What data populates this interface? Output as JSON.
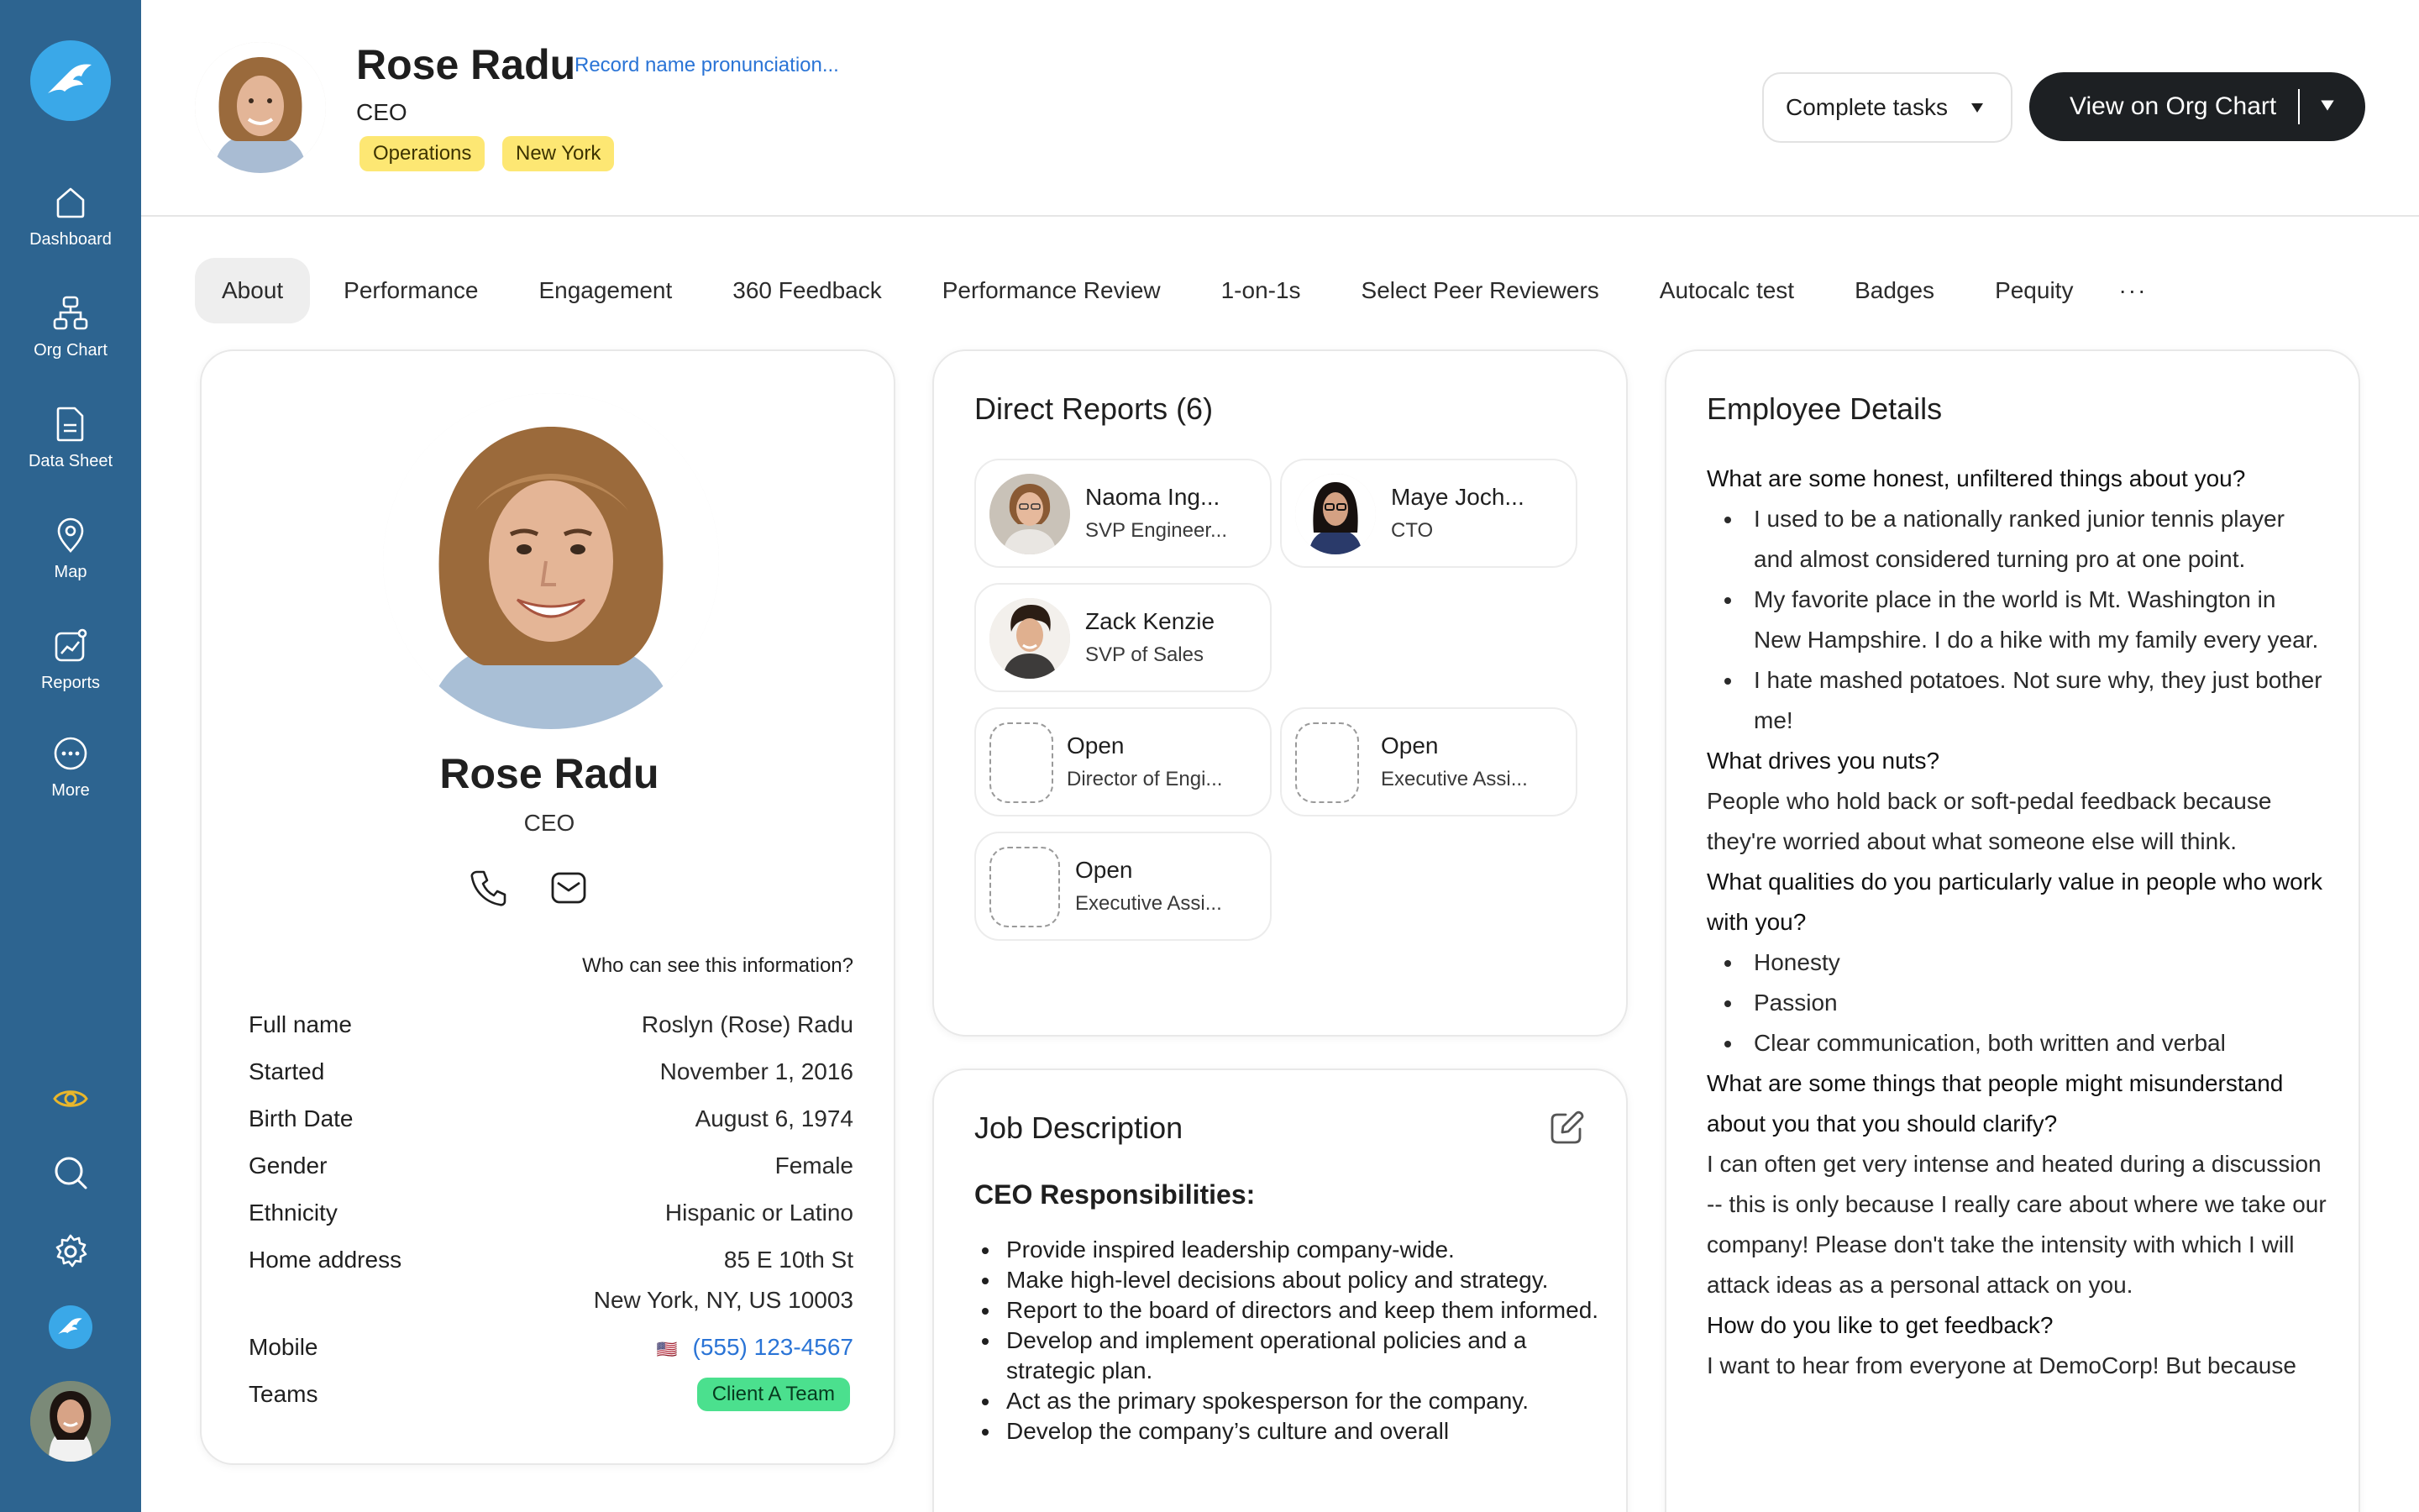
{
  "sidebar": {
    "nav": [
      {
        "label": "Dashboard",
        "icon": "home-icon"
      },
      {
        "label": "Org Chart",
        "icon": "org-chart-icon"
      },
      {
        "label": "Data Sheet",
        "icon": "data-sheet-icon"
      },
      {
        "label": "Map",
        "icon": "map-pin-icon"
      },
      {
        "label": "Reports",
        "icon": "reports-icon"
      },
      {
        "label": "More",
        "icon": "more-icon"
      }
    ],
    "bottom_icons": [
      "eye-icon",
      "search-icon",
      "gear-icon",
      "app-logo-icon",
      "user-avatar"
    ],
    "colors": {
      "background": "#2d6490",
      "logo": "#3aa8e8",
      "eye": "#e8b62c"
    }
  },
  "header": {
    "name": "Rose Radu",
    "pronunciation_link": "Record name pronunciation...",
    "title": "CEO",
    "tags": [
      "Operations",
      "New York"
    ],
    "complete_tasks_label": "Complete tasks",
    "org_chart_label": "View on Org Chart"
  },
  "tabs": [
    "About",
    "Performance",
    "Engagement",
    "360 Feedback",
    "Performance Review",
    "1-on-1s",
    "Select Peer Reviewers",
    "Autocalc test",
    "Badges",
    "Pequity"
  ],
  "tabs_more": "···",
  "profile": {
    "name": "Rose Radu",
    "title": "CEO",
    "privacy_link": "Who can see this information?",
    "fields": {
      "full_name_label": "Full name",
      "full_name": "Roslyn (Rose) Radu",
      "started_label": "Started",
      "started": "November 1, 2016",
      "birth_label": "Birth Date",
      "birth": "August 6, 1974",
      "gender_label": "Gender",
      "gender": "Female",
      "ethnicity_label": "Ethnicity",
      "ethnicity": "Hispanic or Latino",
      "address_label": "Home address",
      "address_line1": "85 E 10th St",
      "address_line2": "New York, NY, US 10003",
      "mobile_label": "Mobile",
      "mobile_flag": "🇺🇸",
      "mobile": "(555) 123-4567",
      "teams_label": "Teams",
      "team": "Client A Team"
    }
  },
  "direct_reports": {
    "title": "Direct Reports (6)",
    "people": [
      {
        "name": "Naoma Ing...",
        "role": "SVP Engineer..."
      },
      {
        "name": "Maye Joch...",
        "role": "CTO"
      },
      {
        "name": "Zack Kenzie",
        "role": "SVP of Sales"
      },
      {
        "name": "Open",
        "role": "Director of Engi..."
      },
      {
        "name": "Open",
        "role": "Executive Assi..."
      },
      {
        "name": "Open",
        "role": "Executive Assi..."
      }
    ]
  },
  "job_description": {
    "title": "Job Description",
    "subtitle": "CEO Responsibilities:",
    "items": [
      "Provide inspired leadership company-wide.",
      "Make high-level decisions about policy and strategy.",
      "Report to the board of directors and keep them informed.",
      "Develop and implement operational policies and a strategic plan.",
      "Act as the primary spokesperson for the company.",
      "Develop the company’s culture and overall"
    ]
  },
  "employee_details": {
    "title": "Employee Details",
    "q1": "What are some honest, unfiltered things about you?",
    "q1_items": [
      "I used to be a nationally ranked junior tennis player and almost considered turning pro at one point.",
      "My favorite place in the world is Mt. Washington in New Hampshire. I do a hike with my family every year.",
      "I hate mashed potatoes. Not sure why, they just bother me!"
    ],
    "q2": "What drives you nuts?",
    "a2": "People who hold back or soft-pedal feedback because they're worried about what someone else will think.",
    "q3": "What qualities do you particularly value in people who work with you?",
    "q3_items": [
      "Honesty",
      "Passion",
      "Clear communication, both written and verbal"
    ],
    "q4": "What are some things that people might misunderstand about you that you should clarify?",
    "a4": "I can often get very intense and heated during a discussion -- this is only because I really care about where we take our company! Please don't take the intensity with which I will attack ideas as a personal attack on you.",
    "q5": "How do you like to get feedback?",
    "a5": "I want to hear from everyone at DemoCorp! But because"
  }
}
